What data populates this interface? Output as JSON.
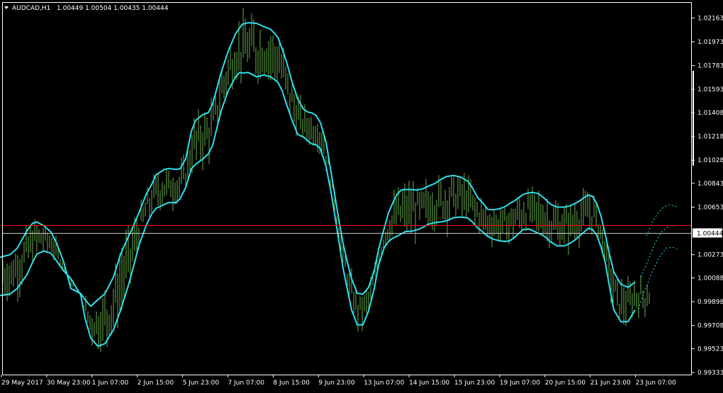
{
  "header": {
    "symbol_label": "AUDCAD,H1",
    "ohlc": "1.00449 1.00504 1.00435 1.00444"
  },
  "chart_data": {
    "type": "line",
    "instrument": "AUDCAD,H1",
    "ylim": [
      0.99333,
      1.0225
    ],
    "y_ticks": [
      1.02163,
      1.01973,
      1.01783,
      1.01593,
      1.01408,
      1.01218,
      1.01028,
      1.00843,
      1.00653,
      1.00273,
      1.00088,
      0.99898,
      0.99708,
      0.99523,
      0.99333
    ],
    "x_tick_labels": [
      "29 May 2017",
      "30 May 23:00",
      "1 Jun 07:00",
      "2 Jun 15:00",
      "5 Jun 23:00",
      "7 Jun 07:00",
      "8 Jun 15:00",
      "9 Jun 23:00",
      "13 Jun 07:00",
      "14 Jun 15:00",
      "15 Jun 23:00",
      "19 Jun 07:00",
      "20 Jun 15:00",
      "21 Jun 23:00",
      "23 Jun 07:00"
    ],
    "current_price": 1.00444,
    "current_price_label": "1.00444",
    "horizontal_level": 1.00506,
    "colors": {
      "background": "#000000",
      "bars": "#6ab04c",
      "bands": "#2de0ee",
      "price_line": "#c8c8c8",
      "level_line": "#ff0000",
      "text": "#ffffff"
    },
    "series": [
      {
        "name": "upper band",
        "x": [
          0,
          14,
          24,
          38,
          46,
          52,
          62,
          72,
          80,
          90,
          100,
          114,
          120,
          128,
          138,
          148,
          160,
          170,
          180,
          186,
          196,
          206,
          214,
          220,
          232,
          238,
          248,
          254,
          262,
          270,
          276,
          286,
          294,
          300,
          306,
          312,
          322,
          332,
          338,
          342,
          350,
          356,
          362,
          372,
          382,
          392,
          398,
          404,
          412,
          420,
          428,
          434,
          440,
          446,
          452,
          460,
          468,
          478,
          484,
          490,
          496,
          504,
          512,
          520,
          528,
          534,
          542,
          548,
          554,
          560,
          566,
          572,
          580,
          588,
          596,
          604,
          614,
          622,
          630,
          640,
          650,
          660,
          666,
          674,
          682,
          688,
          696,
          706,
          714,
          720,
          726,
          732,
          738,
          746,
          752,
          760,
          764,
          770,
          776,
          786,
          796,
          804,
          812,
          818,
          824,
          830,
          836,
          842,
          848,
          854,
          860,
          866,
          876,
          886,
          896
        ],
        "y": [
          1.00253,
          1.00273,
          1.00323,
          1.00463,
          1.00524,
          1.00534,
          1.00504,
          1.00453,
          1.00364,
          1.00213,
          1.00003,
          0.99963,
          0.99913,
          0.99862,
          0.99913,
          0.99963,
          1.00094,
          1.00275,
          1.00404,
          1.00475,
          1.00608,
          1.00753,
          1.00834,
          1.00911,
          1.00955,
          1.00961,
          1.00954,
          1.00959,
          1.01039,
          1.01259,
          1.01345,
          1.01391,
          1.01408,
          1.01479,
          1.01601,
          1.01728,
          1.01899,
          1.02034,
          1.02082,
          1.02113,
          1.02125,
          1.02123,
          1.0212,
          1.02094,
          1.02072,
          1.02009,
          1.01918,
          1.01817,
          1.01655,
          1.01515,
          1.01436,
          1.01413,
          1.01405,
          1.01384,
          1.01328,
          1.01172,
          1.00899,
          1.00552,
          1.00364,
          1.00213,
          1.00083,
          0.99965,
          0.99958,
          1.00013,
          1.00148,
          1.00314,
          1.00484,
          1.00607,
          1.00684,
          1.00754,
          1.00789,
          1.00794,
          1.00794,
          1.00789,
          1.00798,
          1.00819,
          1.00843,
          1.00874,
          1.00898,
          1.00905,
          1.00893,
          1.00859,
          1.00812,
          1.00729,
          1.0068,
          1.00635,
          1.00631,
          1.00641,
          1.00662,
          1.00686,
          1.00704,
          1.0073,
          1.00754,
          1.00768,
          1.0077,
          1.00759,
          1.00741,
          1.00713,
          1.00678,
          1.00653,
          1.00653,
          1.00663,
          1.00684,
          1.00704,
          1.0073,
          1.00749,
          1.00739,
          1.0068,
          1.00579,
          1.00432,
          1.00273,
          1.00134,
          1.00037,
          1.00013,
          1.00054
        ]
      },
      {
        "name": "lower band",
        "x": [
          0,
          14,
          24,
          38,
          46,
          52,
          62,
          72,
          80,
          90,
          100,
          114,
          120,
          128,
          138,
          148,
          160,
          170,
          180,
          186,
          196,
          206,
          214,
          220,
          232,
          238,
          248,
          254,
          262,
          270,
          276,
          286,
          294,
          300,
          306,
          312,
          322,
          332,
          338,
          342,
          350,
          356,
          362,
          372,
          382,
          392,
          398,
          404,
          412,
          420,
          428,
          434,
          440,
          446,
          452,
          460,
          468,
          478,
          484,
          490,
          496,
          504,
          512,
          520,
          528,
          534,
          542,
          548,
          554,
          560,
          566,
          572,
          580,
          588,
          596,
          604,
          614,
          622,
          630,
          640,
          650,
          660,
          666,
          674,
          682,
          688,
          696,
          706,
          714,
          720,
          726,
          732,
          738,
          746,
          752,
          760,
          764,
          770,
          776,
          786,
          796,
          804,
          812,
          818,
          824,
          830,
          836,
          842,
          848,
          854,
          860,
          866,
          876,
          886,
          896
        ],
        "y": [
          0.99948,
          0.99958,
          1.00003,
          1.00113,
          1.00213,
          1.00279,
          1.00303,
          1.00284,
          1.00223,
          1.00143,
          1.00083,
          0.99949,
          0.99764,
          0.99608,
          0.99543,
          0.99563,
          0.99673,
          0.99828,
          1.00008,
          1.00128,
          1.00348,
          1.00504,
          1.00599,
          1.00642,
          1.00675,
          1.00689,
          1.00689,
          1.00719,
          1.0081,
          1.00959,
          1.00995,
          1.01036,
          1.01079,
          1.01146,
          1.01285,
          1.01422,
          1.01583,
          1.01689,
          1.01728,
          1.01723,
          1.01728,
          1.01712,
          1.01693,
          1.01708,
          1.01693,
          1.0165,
          1.01583,
          1.01478,
          1.01348,
          1.01233,
          1.01213,
          1.01183,
          1.01158,
          1.0115,
          1.0112,
          1.00978,
          1.00742,
          1.00384,
          1.00164,
          0.99998,
          0.99833,
          0.99713,
          0.99713,
          0.99823,
          1.00003,
          1.00188,
          1.00329,
          1.00378,
          1.00404,
          1.0042,
          1.00439,
          1.00458,
          1.0046,
          1.00471,
          1.00489,
          1.00516,
          1.0053,
          1.00535,
          1.00544,
          1.00569,
          1.00574,
          1.00566,
          1.00537,
          1.00486,
          1.00452,
          1.00419,
          1.00397,
          1.00383,
          1.00378,
          1.00387,
          1.00413,
          1.00444,
          1.00474,
          1.00479,
          1.00464,
          1.00444,
          1.00433,
          1.00413,
          1.00378,
          1.00344,
          1.00343,
          1.00363,
          1.00394,
          1.00426,
          1.00454,
          1.00484,
          1.00473,
          1.00428,
          1.00333,
          1.00208,
          1.00013,
          0.99833,
          0.99738,
          0.99739,
          0.99833
        ]
      },
      {
        "name": "upper projection",
        "x": [
          912,
          920,
          928,
          936,
          944,
          952,
          956
        ],
        "y": [
          1.00424,
          1.00532,
          1.00604,
          1.00653,
          1.00672,
          1.00663,
          1.00653
        ]
      },
      {
        "name": "lower projection",
        "x": [
          900,
          910,
          920,
          930,
          940,
          950,
          956
        ],
        "y": [
          0.99838,
          0.99994,
          1.00134,
          1.00253,
          1.00327,
          1.00331,
          1.00313
        ]
      },
      {
        "name": "middle projection",
        "x": [
          904,
          914,
          924,
          934,
          944,
          952
        ],
        "y": [
          1.00094,
          1.00224,
          1.00364,
          1.0046,
          1.00504,
          1.00504
        ]
      }
    ]
  }
}
